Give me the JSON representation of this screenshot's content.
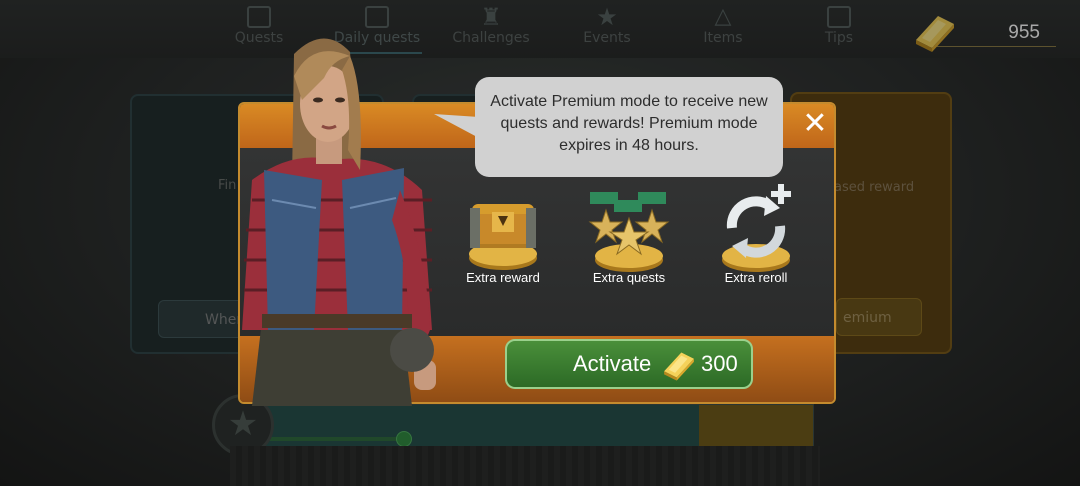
{
  "topnav": {
    "tabs": [
      {
        "label": "Quests",
        "icon": "list-icon"
      },
      {
        "label": "Daily quests",
        "icon": "calendar-icon"
      },
      {
        "label": "Challenges",
        "icon": "trophy-icon"
      },
      {
        "label": "Events",
        "icon": "star-calendar-icon"
      },
      {
        "label": "Items",
        "icon": "triangle-icon"
      },
      {
        "label": "Tips",
        "icon": "list-icon"
      }
    ],
    "active_tab": "Daily quests"
  },
  "currency": {
    "gold": "955",
    "icon": "gold-ingot-icon"
  },
  "background": {
    "card1_text": "Fin",
    "card1_button": "Wher",
    "card3_text": "ased reward",
    "card3_button": "emium"
  },
  "dialog": {
    "bubble_text": "Activate Premium mode to receive new quests and rewards! Premium mode expires in 48 hours.",
    "features": [
      {
        "label": "Extra reward",
        "icon": "chest-icon"
      },
      {
        "label": "Extra quests",
        "icon": "stars-icon"
      },
      {
        "label": "Extra reroll",
        "icon": "reroll-icon"
      }
    ],
    "activate_label": "Activate",
    "activate_cost": "300",
    "close_icon": "close-icon"
  },
  "colors": {
    "header_orange": "#d98a24",
    "button_green": "#3f8433",
    "bubble_gray": "#d1d1d1",
    "gold": "#f2c84b"
  }
}
